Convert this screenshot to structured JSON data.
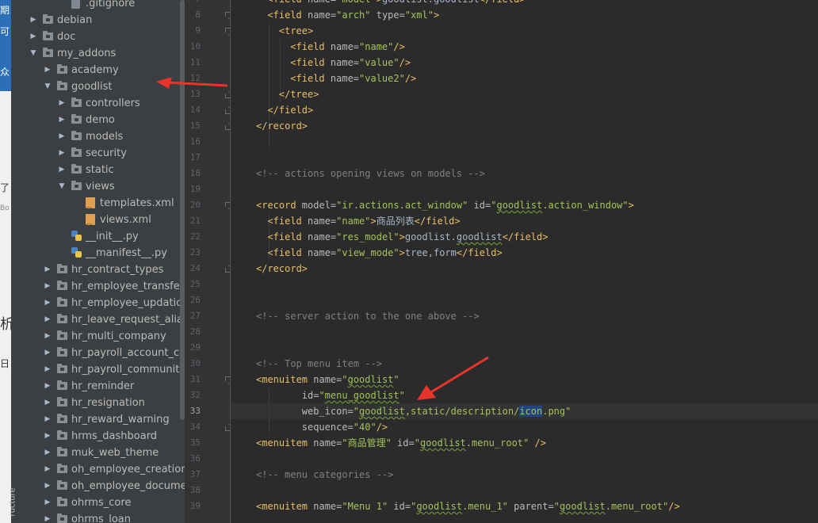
{
  "left_strip": {
    "fragments": [
      "期",
      "可",
      "众",
      "了",
      "Bo",
      "析",
      "日"
    ]
  },
  "structure_tab": "ructure",
  "tree": {
    "items": [
      {
        "label": ".gitignore",
        "type": "file",
        "arrow": "",
        "depth": 2
      },
      {
        "label": "debian",
        "type": "folder",
        "arrow": "collapsed",
        "depth": 0
      },
      {
        "label": "doc",
        "type": "folder",
        "arrow": "collapsed",
        "depth": 0
      },
      {
        "label": "my_addons",
        "type": "folder",
        "arrow": "expanded",
        "depth": 0
      },
      {
        "label": "academy",
        "type": "folder",
        "arrow": "collapsed",
        "depth": 1
      },
      {
        "label": "goodlist",
        "type": "folder",
        "arrow": "expanded",
        "depth": 1
      },
      {
        "label": "controllers",
        "type": "folder",
        "arrow": "collapsed",
        "depth": 2
      },
      {
        "label": "demo",
        "type": "folder",
        "arrow": "collapsed",
        "depth": 2
      },
      {
        "label": "models",
        "type": "folder",
        "arrow": "collapsed",
        "depth": 2
      },
      {
        "label": "security",
        "type": "folder",
        "arrow": "collapsed",
        "depth": 2
      },
      {
        "label": "static",
        "type": "folder",
        "arrow": "collapsed",
        "depth": 2
      },
      {
        "label": "views",
        "type": "folder",
        "arrow": "expanded",
        "depth": 2
      },
      {
        "label": "templates.xml",
        "type": "xml",
        "arrow": "",
        "depth": 3
      },
      {
        "label": "views.xml",
        "type": "xml",
        "arrow": "",
        "depth": 3
      },
      {
        "label": "__init__.py",
        "type": "py",
        "arrow": "",
        "depth": 2
      },
      {
        "label": "__manifest__.py",
        "type": "py",
        "arrow": "",
        "depth": 2
      },
      {
        "label": "hr_contract_types",
        "type": "folder",
        "arrow": "collapsed",
        "depth": 1
      },
      {
        "label": "hr_employee_transfer",
        "type": "folder",
        "arrow": "collapsed",
        "depth": 1
      },
      {
        "label": "hr_employee_updation",
        "type": "folder",
        "arrow": "collapsed",
        "depth": 1
      },
      {
        "label": "hr_leave_request_aliasing",
        "type": "folder",
        "arrow": "collapsed",
        "depth": 1
      },
      {
        "label": "hr_multi_company",
        "type": "folder",
        "arrow": "collapsed",
        "depth": 1
      },
      {
        "label": "hr_payroll_account_community",
        "type": "folder",
        "arrow": "collapsed",
        "depth": 1
      },
      {
        "label": "hr_payroll_community",
        "type": "folder",
        "arrow": "collapsed",
        "depth": 1
      },
      {
        "label": "hr_reminder",
        "type": "folder",
        "arrow": "collapsed",
        "depth": 1
      },
      {
        "label": "hr_resignation",
        "type": "folder",
        "arrow": "collapsed",
        "depth": 1
      },
      {
        "label": "hr_reward_warning",
        "type": "folder",
        "arrow": "collapsed",
        "depth": 1
      },
      {
        "label": "hrms_dashboard",
        "type": "folder",
        "arrow": "collapsed",
        "depth": 1
      },
      {
        "label": "muk_web_theme",
        "type": "folder",
        "arrow": "collapsed",
        "depth": 1
      },
      {
        "label": "oh_employee_creation_from_user",
        "type": "folder",
        "arrow": "collapsed",
        "depth": 1
      },
      {
        "label": "oh_employee_documents_expiry",
        "type": "folder",
        "arrow": "collapsed",
        "depth": 1
      },
      {
        "label": "ohrms_core",
        "type": "folder",
        "arrow": "collapsed",
        "depth": 1
      },
      {
        "label": "ohrms_loan",
        "type": "folder",
        "arrow": "collapsed",
        "depth": 1
      }
    ]
  },
  "editor": {
    "current_line": 33,
    "line_numbers": [
      "7",
      "8",
      "9",
      "10",
      "11",
      "12",
      "13",
      "14",
      "15",
      "16",
      "17",
      "18",
      "19",
      "20",
      "21",
      "22",
      "23",
      "24",
      "25",
      "26",
      "27",
      "28",
      "29",
      "30",
      "31",
      "32",
      "33",
      "34",
      "35",
      "36",
      "37",
      "38",
      "39"
    ],
    "lines": [
      {
        "indent": 2,
        "tokens": [
          [
            "t",
            "<field "
          ],
          [
            "a",
            "name="
          ],
          [
            "v",
            "\"model\""
          ],
          [
            "t",
            ">"
          ],
          [
            "p",
            "goodlist.goodlist"
          ],
          [
            "t",
            "</field>"
          ]
        ]
      },
      {
        "indent": 2,
        "tokens": [
          [
            "t",
            "<field "
          ],
          [
            "a",
            "name="
          ],
          [
            "v",
            "\"arch\""
          ],
          [
            "a",
            " type="
          ],
          [
            "v",
            "\"xml\""
          ],
          [
            "t",
            ">"
          ]
        ]
      },
      {
        "indent": 4,
        "tokens": [
          [
            "t",
            "<tree>"
          ]
        ]
      },
      {
        "indent": 6,
        "tokens": [
          [
            "t",
            "<field "
          ],
          [
            "a",
            "name="
          ],
          [
            "v",
            "\"name\""
          ],
          [
            "t",
            "/>"
          ]
        ]
      },
      {
        "indent": 6,
        "tokens": [
          [
            "t",
            "<field "
          ],
          [
            "a",
            "name="
          ],
          [
            "v",
            "\"value\""
          ],
          [
            "t",
            "/>"
          ]
        ]
      },
      {
        "indent": 6,
        "tokens": [
          [
            "t",
            "<field "
          ],
          [
            "a",
            "name="
          ],
          [
            "v",
            "\"value2\""
          ],
          [
            "t",
            "/>"
          ]
        ]
      },
      {
        "indent": 4,
        "tokens": [
          [
            "t",
            "</tree>"
          ]
        ]
      },
      {
        "indent": 2,
        "tokens": [
          [
            "t",
            "</field>"
          ]
        ]
      },
      {
        "indent": 0,
        "tokens": [
          [
            "t",
            "</record>"
          ]
        ]
      },
      {
        "indent": 0,
        "tokens": []
      },
      {
        "indent": 0,
        "tokens": []
      },
      {
        "indent": 0,
        "tokens": [
          [
            "c",
            "<!-- actions opening views on models -->"
          ]
        ]
      },
      {
        "indent": 0,
        "tokens": []
      },
      {
        "indent": 0,
        "tokens": [
          [
            "t",
            "<record "
          ],
          [
            "a",
            "model="
          ],
          [
            "v",
            "\"ir.actions.act_window\""
          ],
          [
            "a",
            " id="
          ],
          [
            "v",
            "\""
          ],
          [
            "vs",
            "goodlist"
          ],
          [
            "v",
            ".action_window\""
          ],
          [
            "t",
            ">"
          ]
        ]
      },
      {
        "indent": 2,
        "tokens": [
          [
            "t",
            "<field "
          ],
          [
            "a",
            "name="
          ],
          [
            "v",
            "\"name\""
          ],
          [
            "t",
            ">"
          ],
          [
            "p",
            "商品列表"
          ],
          [
            "t",
            "</field>"
          ]
        ]
      },
      {
        "indent": 2,
        "tokens": [
          [
            "t",
            "<field "
          ],
          [
            "a",
            "name="
          ],
          [
            "v",
            "\"res_model\""
          ],
          [
            "t",
            ">"
          ],
          [
            "p",
            "goodlist."
          ],
          [
            "ps",
            "goodlist"
          ],
          [
            "t",
            "</field>"
          ]
        ]
      },
      {
        "indent": 2,
        "tokens": [
          [
            "t",
            "<field "
          ],
          [
            "a",
            "name="
          ],
          [
            "v",
            "\"view_mode\""
          ],
          [
            "t",
            ">"
          ],
          [
            "p",
            "tree,form"
          ],
          [
            "t",
            "</field>"
          ]
        ]
      },
      {
        "indent": 0,
        "tokens": [
          [
            "t",
            "</record>"
          ]
        ]
      },
      {
        "indent": 0,
        "tokens": []
      },
      {
        "indent": 0,
        "tokens": []
      },
      {
        "indent": 0,
        "tokens": [
          [
            "c",
            "<!-- server action to the one above -->"
          ]
        ]
      },
      {
        "indent": 0,
        "tokens": []
      },
      {
        "indent": 0,
        "tokens": []
      },
      {
        "indent": 0,
        "tokens": [
          [
            "c",
            "<!-- Top menu item -->"
          ]
        ]
      },
      {
        "indent": 0,
        "tokens": [
          [
            "t",
            "<menuitem "
          ],
          [
            "a",
            "name="
          ],
          [
            "v",
            "\""
          ],
          [
            "vs",
            "goodlist"
          ],
          [
            "v",
            "\""
          ]
        ]
      },
      {
        "indent": 8,
        "tokens": [
          [
            "a",
            "id="
          ],
          [
            "v",
            "\""
          ],
          [
            "vs",
            "menu_goodlist"
          ],
          [
            "v",
            "\""
          ]
        ]
      },
      {
        "indent": 8,
        "tokens": [
          [
            "a",
            "web_icon="
          ],
          [
            "v",
            "\""
          ],
          [
            "vs",
            "goodlist"
          ],
          [
            "v",
            ",static/description/"
          ],
          [
            "vh",
            "icon"
          ],
          [
            "v",
            ".png\""
          ]
        ]
      },
      {
        "indent": 8,
        "tokens": [
          [
            "a",
            "sequence="
          ],
          [
            "v",
            "\"40\""
          ],
          [
            "t",
            "/>"
          ]
        ]
      },
      {
        "indent": 0,
        "tokens": [
          [
            "t",
            "<menuitem "
          ],
          [
            "a",
            "name="
          ],
          [
            "v",
            "\"商品管理\""
          ],
          [
            "a",
            " id="
          ],
          [
            "v",
            "\""
          ],
          [
            "vs",
            "goodlist"
          ],
          [
            "v",
            ".menu_root\""
          ],
          [
            "t",
            " />"
          ]
        ]
      },
      {
        "indent": 0,
        "tokens": []
      },
      {
        "indent": 0,
        "tokens": [
          [
            "c",
            "<!-- menu categories -->"
          ]
        ]
      },
      {
        "indent": 0,
        "tokens": []
      },
      {
        "indent": 0,
        "tokens": [
          [
            "t",
            "<menuitem "
          ],
          [
            "a",
            "name="
          ],
          [
            "v",
            "\"Menu 1\""
          ],
          [
            "a",
            " id="
          ],
          [
            "v",
            "\""
          ],
          [
            "vs",
            "goodlist"
          ],
          [
            "v",
            ".menu_1\""
          ],
          [
            "a",
            " parent="
          ],
          [
            "v",
            "\""
          ],
          [
            "vs",
            "goodlist"
          ],
          [
            "v",
            ".menu_root\""
          ],
          [
            "t",
            "/>"
          ]
        ]
      }
    ],
    "folds": [
      {
        "line": 8,
        "kind": "open"
      },
      {
        "line": 9,
        "kind": "open"
      },
      {
        "line": 13,
        "kind": "close"
      },
      {
        "line": 14,
        "kind": "close"
      },
      {
        "line": 15,
        "kind": "close"
      },
      {
        "line": 20,
        "kind": "open"
      },
      {
        "line": 24,
        "kind": "close"
      },
      {
        "line": 31,
        "kind": "open"
      },
      {
        "line": 34,
        "kind": "close"
      }
    ]
  },
  "annotations": {
    "color": "#e8342a"
  }
}
